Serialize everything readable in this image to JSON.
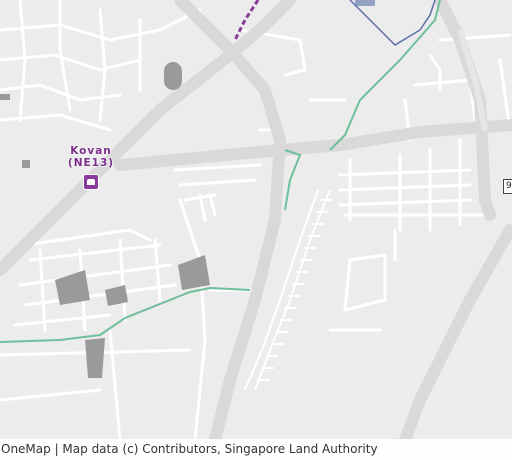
{
  "map": {
    "station": {
      "name": "Kovan",
      "code": "(NE13)"
    },
    "road_shield": "9",
    "colors": {
      "background": "#ececec",
      "road": "#ffffff",
      "major_road": "#d9d9d9",
      "block": "#9a9a9a",
      "park_connector": "#6fbf9a",
      "boundary": "#5b6fa8",
      "mrt_line": "#8a3a9a"
    },
    "icons": [
      "train-station-icon"
    ]
  },
  "footer": {
    "attribution": "OneMap | Map data (c) Contributors, Singapore Land Authority"
  }
}
